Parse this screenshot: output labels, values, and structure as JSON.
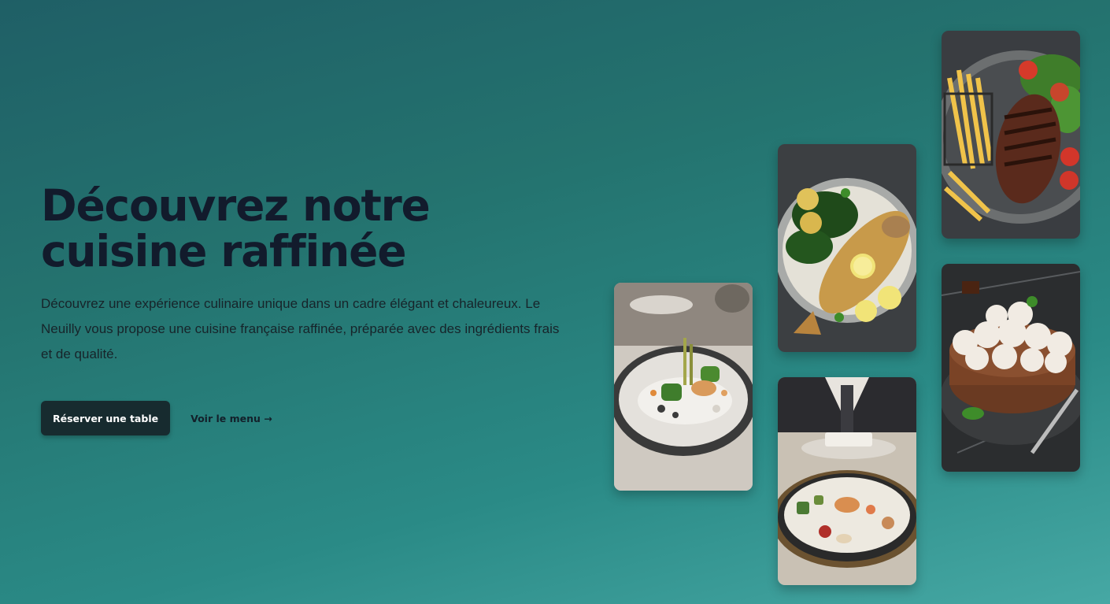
{
  "hero": {
    "title": "Découvrez notre cuisine raffinée",
    "description": "Découvrez une expérience culinaire unique dans un cadre élégant et chaleureux. Le Neuilly vous propose une cuisine française raffinée, préparée avec des ingrédients frais et de qualité.",
    "primary_cta": "Réserver une table",
    "secondary_cta": "Voir le menu →"
  },
  "gallery": {
    "photos": [
      {
        "name": "gourmet-vegetable-plate-photo"
      },
      {
        "name": "grilled-fish-lemon-photo"
      },
      {
        "name": "fine-dining-plate-photo"
      },
      {
        "name": "steak-fries-photo"
      },
      {
        "name": "chocolate-mousse-cake-photo"
      }
    ]
  },
  "colors": {
    "background_start": "#1f5f66",
    "background_end": "#46a8a4",
    "title": "#121b2c",
    "button_bg": "#172b2f",
    "button_text": "#ffffff"
  }
}
